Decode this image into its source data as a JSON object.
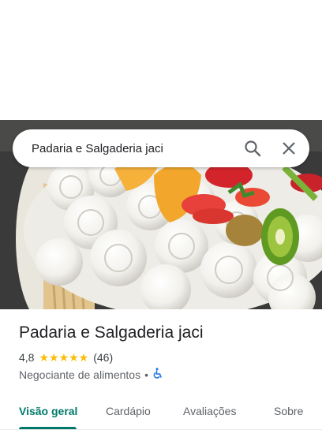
{
  "search": {
    "query": "Padaria e Salgaderia jaci"
  },
  "place": {
    "name": "Padaria e Salgaderia jaci",
    "rating": "4,8",
    "stars": "★★★★★",
    "review_count": "(46)",
    "category": "Negociante de alimentos",
    "separator": "•"
  },
  "tabs": [
    {
      "label": "Visão geral"
    },
    {
      "label": "Cardápio"
    },
    {
      "label": "Avaliações"
    },
    {
      "label": "Sobre"
    }
  ],
  "colors": {
    "accent": "#00796b",
    "star": "#fbbc04",
    "accessibility": "#1a73e8"
  },
  "icons": [
    "search-icon",
    "close-icon",
    "wheelchair-icon"
  ]
}
